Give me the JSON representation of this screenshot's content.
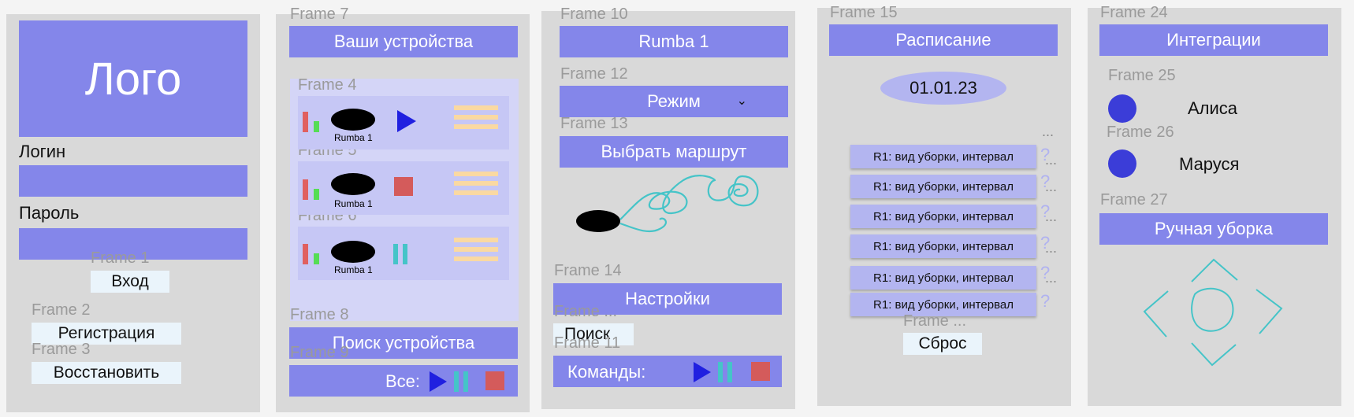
{
  "screen1": {
    "logo": "Лого",
    "login_label": "Логин",
    "password_label": "Пароль",
    "frame1": "Frame 1",
    "login_button": "Вход",
    "frame2": "Frame 2",
    "register_button": "Регистрация",
    "frame3": "Frame 3",
    "restore_button": "Восстановить"
  },
  "screen2": {
    "frame7": "Frame 7",
    "title": "Ваши устройства",
    "frame4": "Frame 4",
    "frame5": "Frame 5",
    "frame6": "Frame 6",
    "devices": [
      {
        "name": "Rumba 1",
        "control": "play-icon"
      },
      {
        "name": "Rumba 1",
        "control": "stop-icon"
      },
      {
        "name": "Rumba 1",
        "control": "pause-icon"
      }
    ],
    "frame8": "Frame 8",
    "search_button": "Поиск устройства",
    "frame9": "Frame 9",
    "all_label": "Все:"
  },
  "screen3": {
    "frame10": "Frame 10",
    "title": "Rumba 1",
    "frame12": "Frame 12",
    "mode_select": "Режим",
    "frame13": "Frame 13",
    "route_button": "Выбрать маршрут",
    "frame14": "Frame 14",
    "settings_button": "Настройки",
    "frame_dots": "Frame ...",
    "search_button": "Поиск",
    "frame11": "Frame 11",
    "commands_label": "Команды:"
  },
  "screen4": {
    "frame15": "Frame 15",
    "title": "Расписание",
    "date": "01.01.23",
    "items": [
      "R1: вид уборки, интервал",
      "R1: вид уборки, интервал",
      "R1: вид уборки, интервал",
      "R1: вид уборки, интервал",
      "R1: вид уборки, интервал",
      "R1: вид уборки, интервал"
    ],
    "frame_dots": "Frame ...",
    "reset_button": "Сброс"
  },
  "screen5": {
    "frame24": "Frame 24",
    "title": "Интеграции",
    "frame25": "Frame 25",
    "alice": "Алиса",
    "frame26": "Frame 26",
    "marusya": "Маруся",
    "frame27": "Frame 27",
    "manual_button": "Ручная уборка"
  },
  "colors": {
    "panel": "#d9d9d9",
    "primary": "#8486ea",
    "light_button": "#eaf4fb",
    "card": "#c6c7f5",
    "accent_blue": "#2020e0",
    "pause_teal": "#45c4c8",
    "stop_red": "#d45b5b"
  }
}
